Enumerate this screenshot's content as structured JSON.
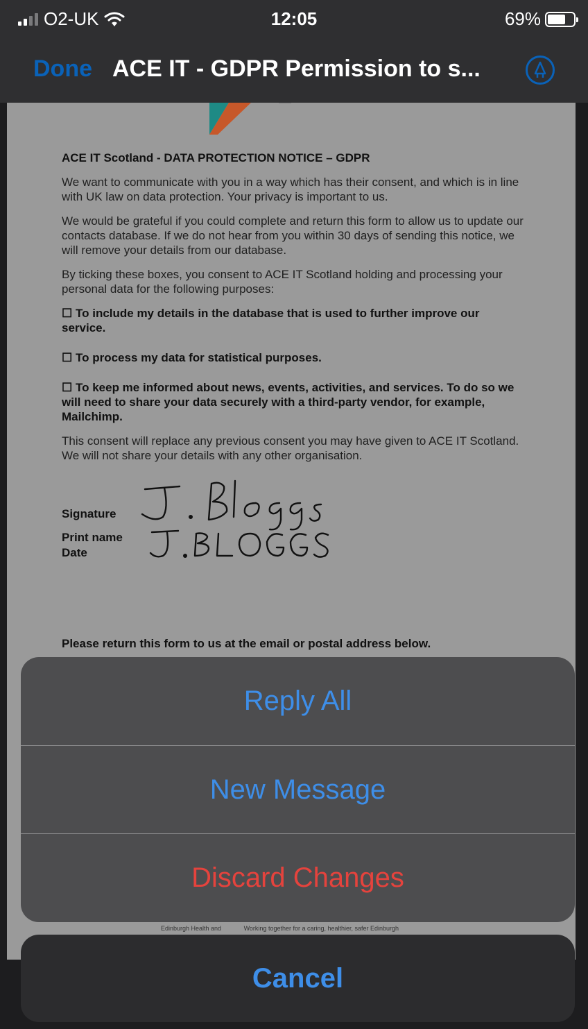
{
  "status_bar": {
    "carrier": "O2-UK",
    "time": "12:05",
    "battery_percent": "69%",
    "battery_level": 0.69,
    "icons": [
      "signal-bars-icon",
      "wifi-icon",
      "battery-icon"
    ]
  },
  "nav": {
    "done_label": "Done",
    "title": "ACE IT - GDPR Permission to s...",
    "markup_icon": "markup-pen-icon",
    "accent_color": "#0a62b8"
  },
  "document": {
    "heading": "ACE IT Scotland - DATA PROTECTION NOTICE – GDPR",
    "paragraphs": [
      "We want to communicate with you in a way which has their consent, and which is in line with UK law on data protection. Your privacy is important to us.",
      "We would be grateful if you could complete and return this form to allow us to update our contacts database. If we do not hear from you within 30 days of sending this notice, we will remove your details from our database.",
      "By ticking these boxes, you consent to ACE IT Scotland holding and processing your personal data for the following purposes:"
    ],
    "checkboxes": [
      "To include my details in the database that is used to further improve our service.",
      "To process my data for statistical purposes.",
      "To keep me informed about news, events, activities, and services. To do so we will need to share your data securely with a third-party vendor, for example, Mailchimp."
    ],
    "closing_paragraph": "This consent will replace any previous consent you may have given to ACE IT Scotland. We will not share your details with any other organisation.",
    "signature_label": "Signature",
    "print_name_label": "Print name",
    "date_label": "Date",
    "signature_value": "J. Bloggs",
    "print_name_value": "J.BLOGGS",
    "return_note": "Please return this form to us at the email or postal address below.",
    "footer_left": "Edinburgh Health and",
    "footer_right": "Working together for a caring, healthier, safer Edinburgh"
  },
  "action_sheet": {
    "items": [
      {
        "label": "Reply All",
        "style": "default"
      },
      {
        "label": "New Message",
        "style": "default"
      },
      {
        "label": "Discard Changes",
        "style": "destructive"
      }
    ],
    "cancel_label": "Cancel",
    "button_color": "#3e8ee8",
    "destructive_color": "#e5433d"
  }
}
